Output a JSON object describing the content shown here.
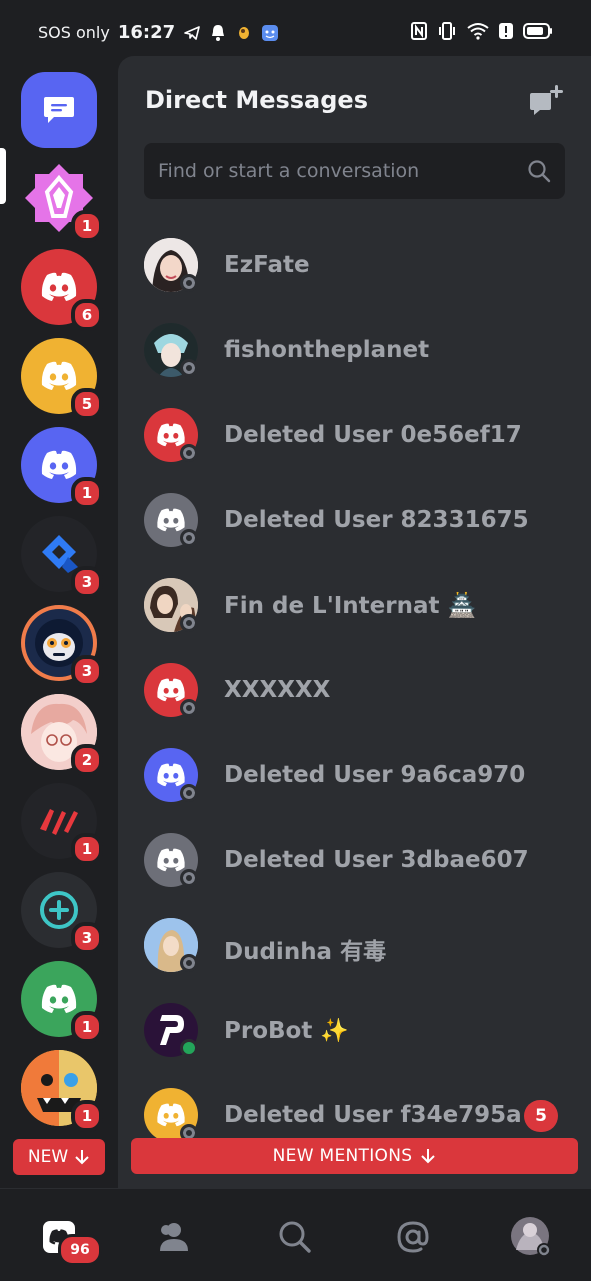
{
  "status_bar": {
    "carrier": "SOS only",
    "time": "16:27"
  },
  "colors": {
    "blurple": "#5865f2",
    "red": "#da373c",
    "yellow": "#f0b232",
    "green": "#23a55a",
    "gray": "#4e5058"
  },
  "servers": [
    {
      "name": "direct-messages",
      "badge": ""
    },
    {
      "name": "nitro-server",
      "badge": "1"
    },
    {
      "name": "red-server",
      "badge": "6"
    },
    {
      "name": "yellow-server",
      "badge": "5"
    },
    {
      "name": "blurple-server",
      "badge": "1"
    },
    {
      "name": "blue-arrow-server",
      "badge": "3"
    },
    {
      "name": "robot-server",
      "badge": "3"
    },
    {
      "name": "anime-girl-server",
      "badge": "2"
    },
    {
      "name": "red-logo-server",
      "badge": "1"
    },
    {
      "name": "add-circle-server",
      "badge": "3"
    },
    {
      "name": "green-server",
      "badge": "1"
    },
    {
      "name": "monster-server",
      "badge": "1"
    }
  ],
  "rail": {
    "new_label": "NEW"
  },
  "dm_panel": {
    "title": "Direct Messages",
    "search_placeholder": "Find or start a conversation",
    "items": [
      {
        "name": "EzFate",
        "status": "offline",
        "unread": ""
      },
      {
        "name": "fishontheplanet",
        "status": "offline",
        "unread": ""
      },
      {
        "name": "Deleted User 0e56ef17",
        "status": "offline",
        "unread": ""
      },
      {
        "name": "Deleted User 82331675",
        "status": "offline",
        "unread": ""
      },
      {
        "name": "Fin de L'Internat 🏯",
        "status": "offline",
        "unread": ""
      },
      {
        "name": "XXXXXX",
        "status": "offline",
        "unread": ""
      },
      {
        "name": "Deleted User 9a6ca970",
        "status": "offline",
        "unread": ""
      },
      {
        "name": "Deleted User 3dbae607",
        "status": "offline",
        "unread": ""
      },
      {
        "name": "Dudinha 有毒",
        "status": "offline",
        "unread": ""
      },
      {
        "name": "ProBot ✨",
        "status": "online",
        "unread": ""
      },
      {
        "name": "Deleted User f34e795a",
        "status": "offline",
        "unread": "5"
      }
    ],
    "new_mentions_label": "NEW MENTIONS"
  },
  "bottom_nav": {
    "home_badge": "96"
  }
}
